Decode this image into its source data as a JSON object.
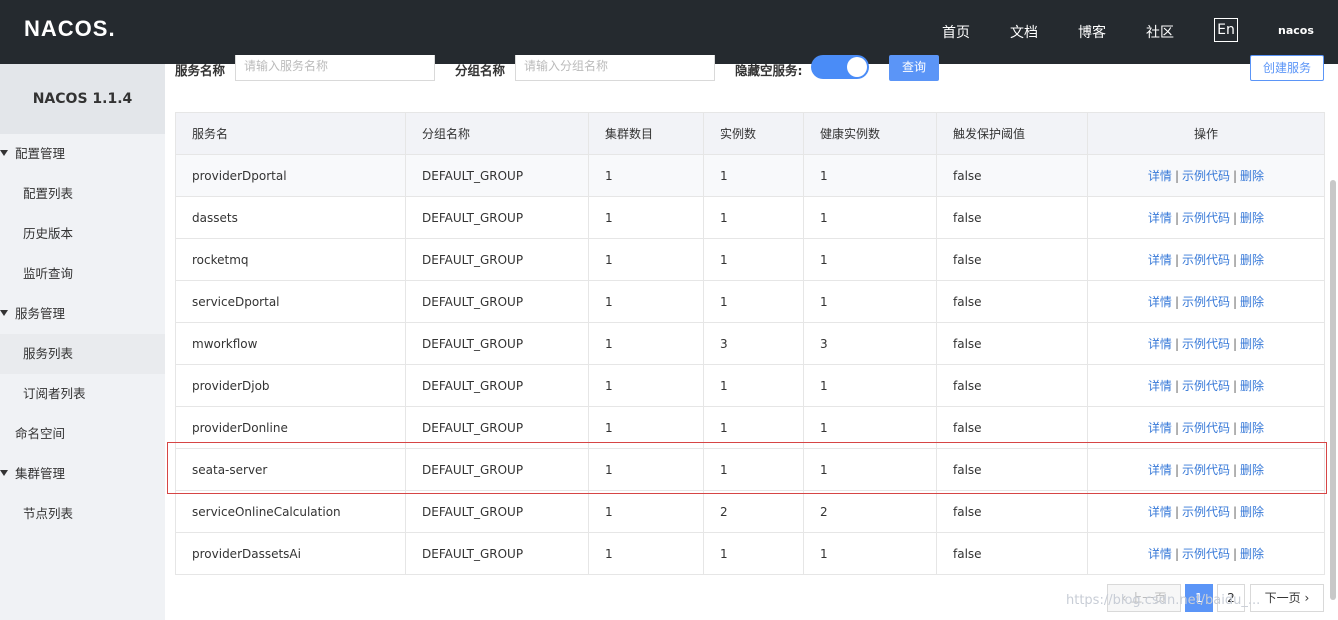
{
  "header": {
    "logo": "NACOS.",
    "nav": [
      "首页",
      "文档",
      "博客",
      "社区"
    ],
    "lang": "En",
    "user": "nacos"
  },
  "sidebar": {
    "title": "NACOS 1.1.4",
    "items": [
      {
        "label": "配置管理",
        "type": "group"
      },
      {
        "label": "配置列表",
        "type": "sub"
      },
      {
        "label": "历史版本",
        "type": "sub"
      },
      {
        "label": "监听查询",
        "type": "sub"
      },
      {
        "label": "服务管理",
        "type": "group"
      },
      {
        "label": "服务列表",
        "type": "sub",
        "active": true
      },
      {
        "label": "订阅者列表",
        "type": "sub"
      },
      {
        "label": "命名空间",
        "type": "plain"
      },
      {
        "label": "集群管理",
        "type": "group"
      },
      {
        "label": "节点列表",
        "type": "sub"
      }
    ]
  },
  "filters": {
    "service_label": "服务名称",
    "service_placeholder": "请输入服务名称",
    "group_label": "分组名称",
    "group_placeholder": "请输入分组名称",
    "hide_empty_label": "隐藏空服务:",
    "hide_empty_on": true,
    "query_button": "查询",
    "create_button": "创建服务"
  },
  "table": {
    "columns": [
      "服务名",
      "分组名称",
      "集群数目",
      "实例数",
      "健康实例数",
      "触发保护阈值",
      "操作"
    ],
    "ops": [
      "详情",
      "示例代码",
      "删除"
    ],
    "rows": [
      [
        "providerDportal",
        "DEFAULT_GROUP",
        "1",
        "1",
        "1",
        "false"
      ],
      [
        "dassets",
        "DEFAULT_GROUP",
        "1",
        "1",
        "1",
        "false"
      ],
      [
        "rocketmq",
        "DEFAULT_GROUP",
        "1",
        "1",
        "1",
        "false"
      ],
      [
        "serviceDportal",
        "DEFAULT_GROUP",
        "1",
        "1",
        "1",
        "false"
      ],
      [
        "mworkflow",
        "DEFAULT_GROUP",
        "1",
        "3",
        "3",
        "false"
      ],
      [
        "providerDjob",
        "DEFAULT_GROUP",
        "1",
        "1",
        "1",
        "false"
      ],
      [
        "providerDonline",
        "DEFAULT_GROUP",
        "1",
        "1",
        "1",
        "false"
      ],
      [
        "seata-server",
        "DEFAULT_GROUP",
        "1",
        "1",
        "1",
        "false"
      ],
      [
        "serviceOnlineCalculation",
        "DEFAULT_GROUP",
        "1",
        "2",
        "2",
        "false"
      ],
      [
        "providerDassetsAi",
        "DEFAULT_GROUP",
        "1",
        "1",
        "1",
        "false"
      ]
    ]
  },
  "pagination": {
    "prev": "上一页",
    "pages": [
      "1",
      "2"
    ],
    "current": "1",
    "next": "下一页"
  },
  "watermark": "https://blog.csdn.net/baidu_..."
}
